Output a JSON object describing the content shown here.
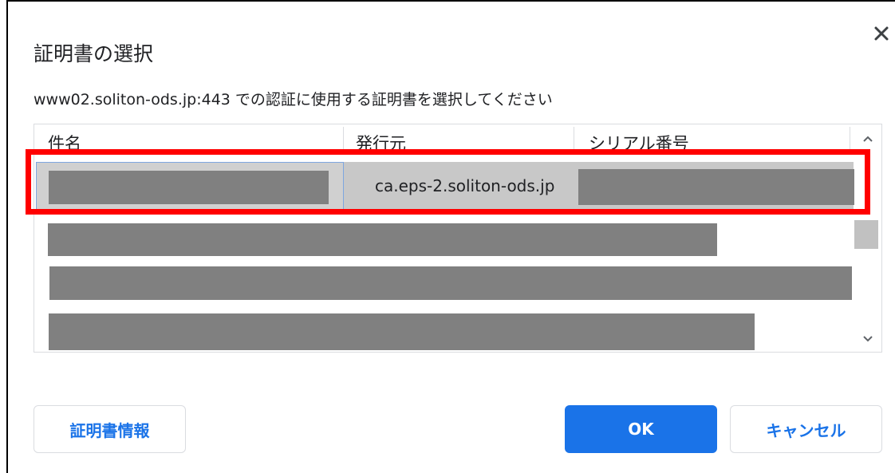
{
  "dialog": {
    "title": "証明書の選択",
    "subtitle": "www02.soliton-ods.jp:443 での認証に使用する証明書を選択してください",
    "close_icon": "close-icon"
  },
  "table": {
    "columns": [
      "件名",
      "発行元",
      "シリアル番号"
    ],
    "rows": [
      {
        "subject": "",
        "issuer": "ca.eps-2.soliton-ods.jp",
        "serial": "",
        "selected": true,
        "redacted": true
      },
      {
        "subject": "",
        "issuer": "",
        "serial": "",
        "selected": false,
        "redacted": true
      },
      {
        "subject": "",
        "issuer": "",
        "serial": "",
        "selected": false,
        "redacted": true
      },
      {
        "subject": "",
        "issuer": "",
        "serial": "",
        "selected": false,
        "redacted": true
      }
    ]
  },
  "buttons": {
    "info": "証明書情報",
    "ok": "OK",
    "cancel": "キャンセル"
  },
  "colors": {
    "accent": "#1a73e8",
    "highlight": "#ff0000",
    "redaction": "#808080"
  }
}
